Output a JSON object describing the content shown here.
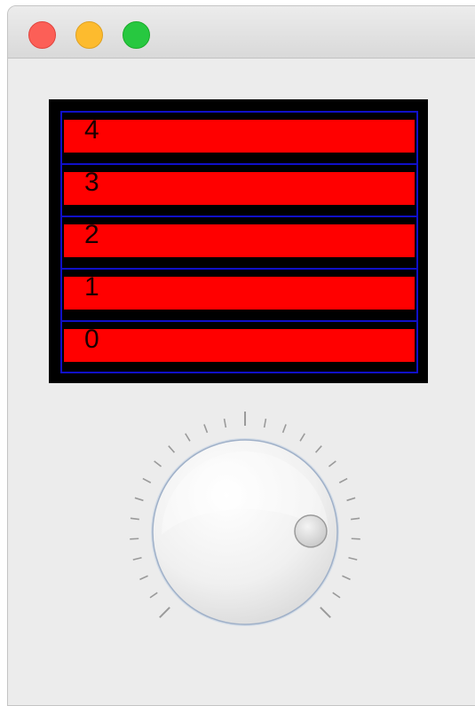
{
  "window": {
    "buttons": [
      "close",
      "minimize",
      "zoom"
    ]
  },
  "bar_graph": {
    "bars": [
      {
        "label": "4",
        "level": 1.0
      },
      {
        "label": "3",
        "level": 1.0
      },
      {
        "label": "2",
        "level": 1.0
      },
      {
        "label": "1",
        "level": 1.0
      },
      {
        "label": "0",
        "level": 1.0
      }
    ],
    "colors": {
      "background": "#000000",
      "bar": "#ff0000",
      "grid": "#1010c8"
    }
  },
  "knob": {
    "value_fraction": 0.83,
    "tick_count": 27,
    "major_tick_every": 13
  }
}
